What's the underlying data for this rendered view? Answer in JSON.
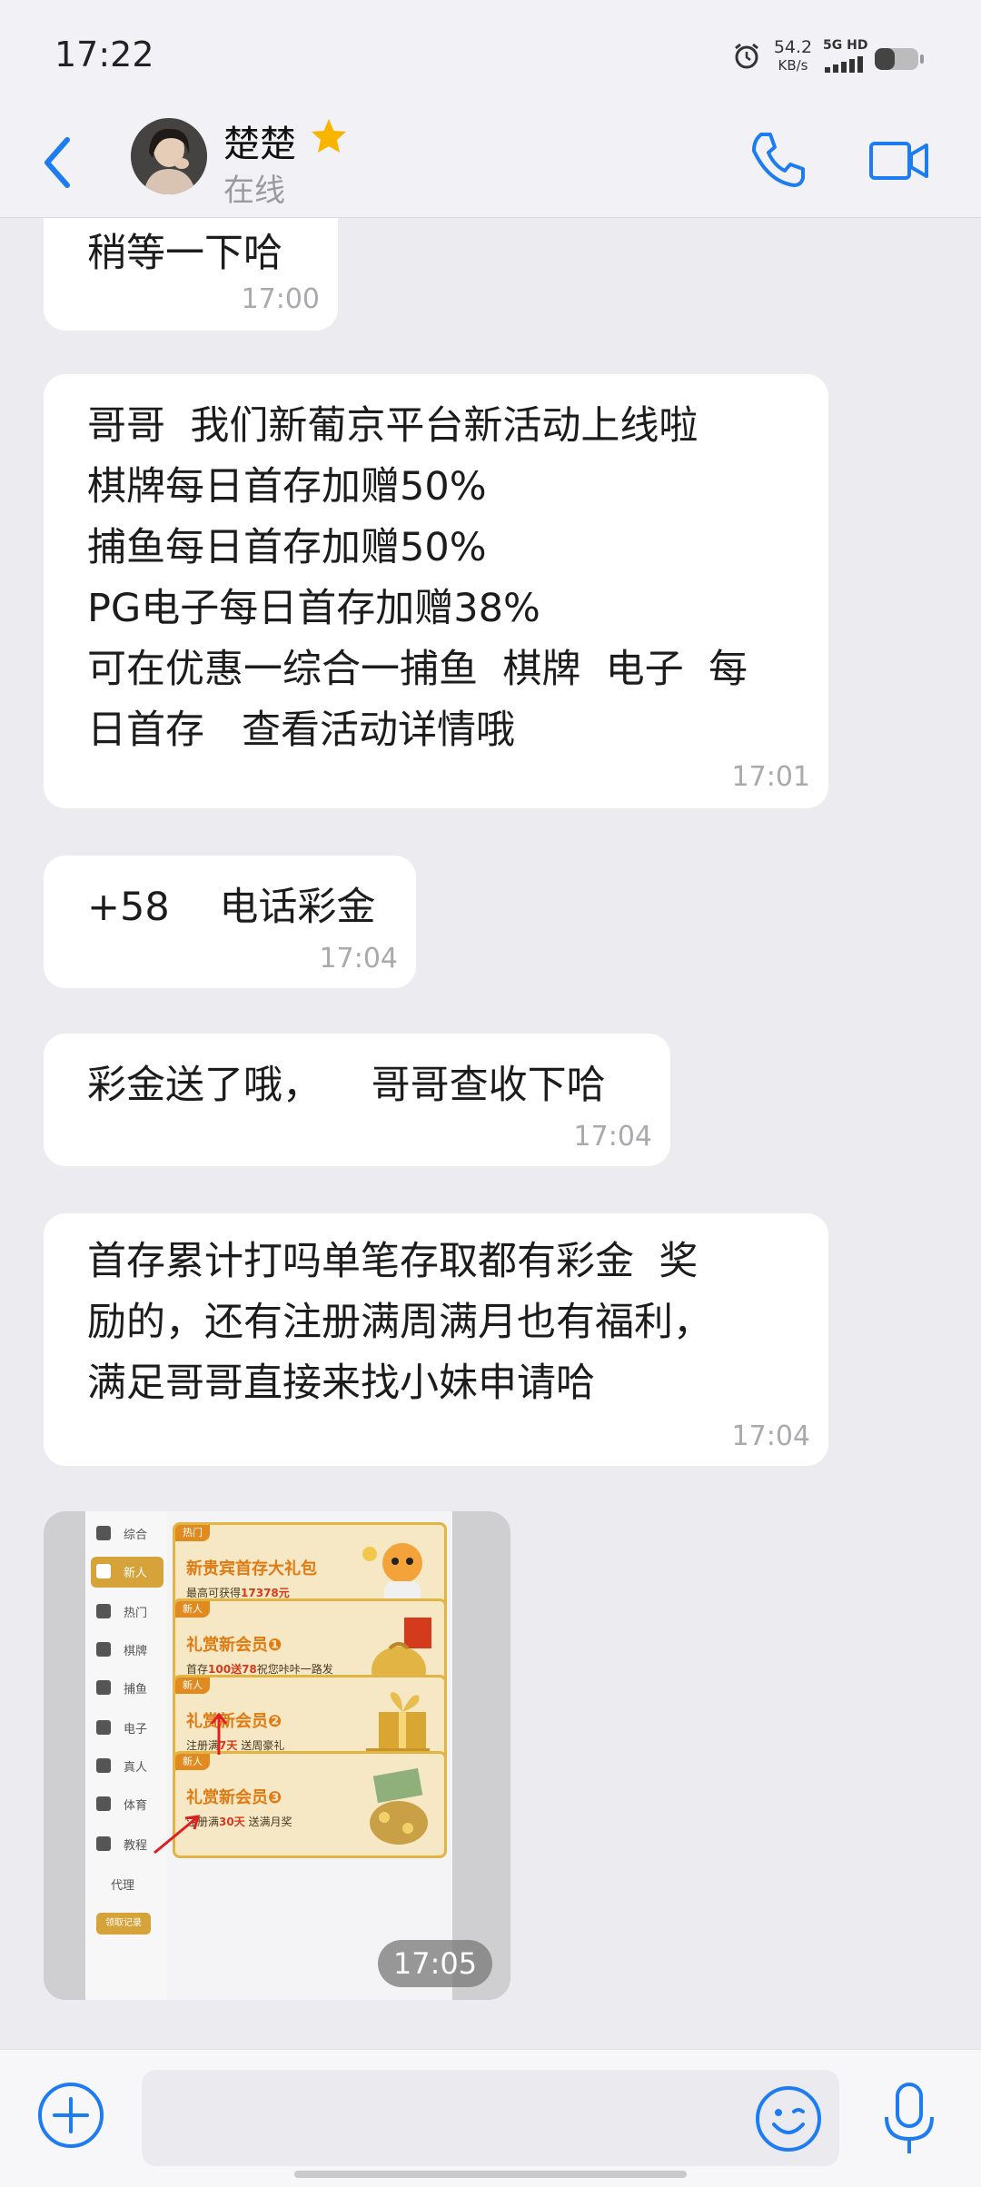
{
  "status_bar": {
    "time": "17:22",
    "speed_value": "54.2",
    "speed_unit": "KB/s",
    "network": "5G HD",
    "battery_level": 0.45
  },
  "header": {
    "contact_name": "楚楚",
    "presence": "在线"
  },
  "messages": [
    {
      "text": "稍等一下哈",
      "time": "17:00"
    },
    {
      "text": "哥哥  我们新葡京平台新活动上线啦\n棋牌每日首存加赠50%\n捕鱼每日首存加赠50%\nPG电子每日首存加赠38%\n可在优惠一综合一捕鱼  棋牌  电子  每\n日首存   查看活动详情哦",
      "time": "17:01"
    },
    {
      "text": "+58    电话彩金",
      "time": "17:04"
    },
    {
      "text": "彩金送了哦，    哥哥查收下哈",
      "time": "17:04"
    },
    {
      "text": "首存累计打吗单笔存取都有彩金  奖\n励的，还有注册满周满月也有福利，\n满足哥哥直接来找小妹申请哈",
      "time": "17:04"
    }
  ],
  "image_message": {
    "time": "17:05",
    "categories": [
      "综合",
      "新人",
      "热门",
      "棋牌",
      "捕鱼",
      "电子",
      "真人",
      "体育",
      "教程",
      "代理"
    ],
    "record_button": "领取记录",
    "promos": [
      {
        "tag": "热门",
        "title": "新贵宾首存大礼包",
        "subtitle_pre": "最高可获得",
        "subtitle_hl": "17378元",
        "subtitle_post": ""
      },
      {
        "tag": "新人",
        "title": "礼赏新会员❶",
        "subtitle_pre": "首存",
        "subtitle_hl": "100送78",
        "subtitle_post": "祝您咔咔一路发"
      },
      {
        "tag": "新人",
        "title": "礼赏新会员❷",
        "subtitle_pre": "注册满",
        "subtitle_hl": "7天",
        "subtitle_post": " 送周豪礼"
      },
      {
        "tag": "新人",
        "title": "礼赏新会员❸",
        "subtitle_pre": "注册满",
        "subtitle_hl": "30天",
        "subtitle_post": " 送满月奖"
      }
    ]
  },
  "input_bar": {
    "placeholder": ""
  },
  "colors": {
    "accent": "#1d7cf2",
    "background": "#ececf0",
    "bubble": "#ffffff",
    "star": "#f7b500"
  }
}
